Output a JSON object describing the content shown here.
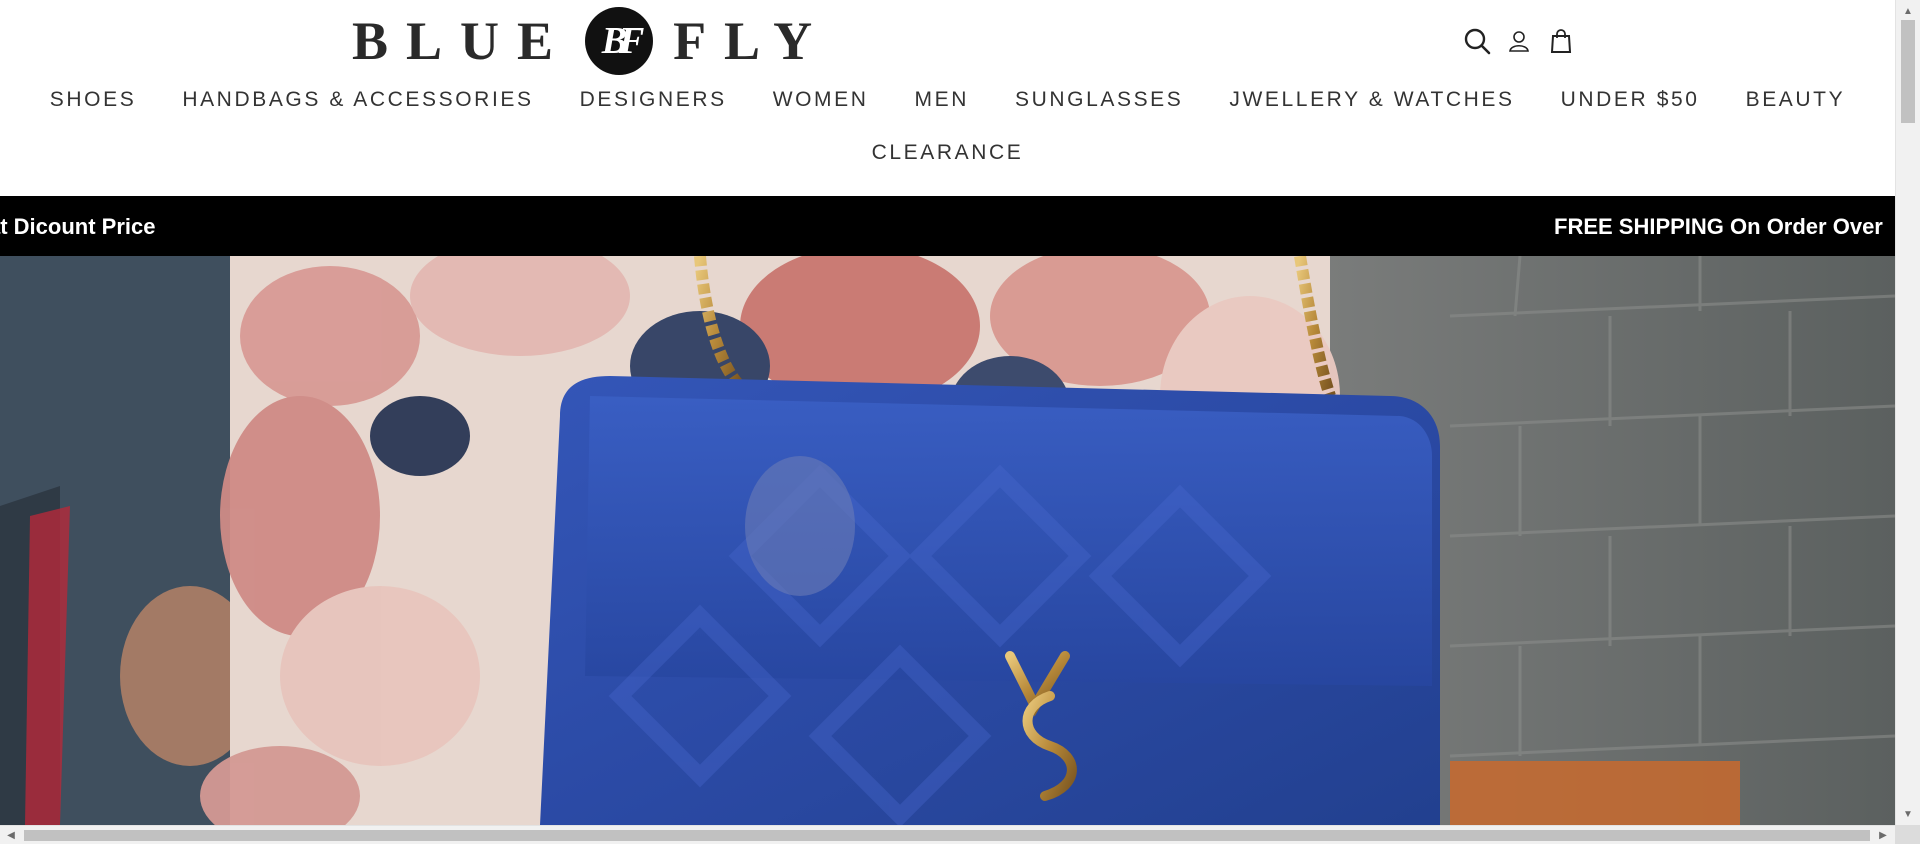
{
  "brand": {
    "logo_left": "BLUE",
    "logo_mark": "BF",
    "logo_right": "FLY"
  },
  "header_icons": [
    {
      "name": "search-icon",
      "label": "Search"
    },
    {
      "name": "account-icon",
      "label": "Account"
    },
    {
      "name": "cart-icon",
      "label": "Cart"
    }
  ],
  "nav": {
    "items": [
      "SHOES",
      "HANDBAGS & ACCESSORIES",
      "DESIGNERS",
      "WOMEN",
      "MEN",
      "SUNGLASSES",
      "JWELLERY & WATCHES",
      "UNDER $50",
      "BEAUTY"
    ],
    "second_row": [
      "CLEARANCE"
    ]
  },
  "announcement": {
    "left_text": "at Dicount Price",
    "right_text": "FREE SHIPPING On Order Over"
  },
  "colors": {
    "announcement_bg": "#000000",
    "announcement_fg": "#ffffff",
    "nav_text": "#333333",
    "bag_blue": "#2b4aa5"
  }
}
